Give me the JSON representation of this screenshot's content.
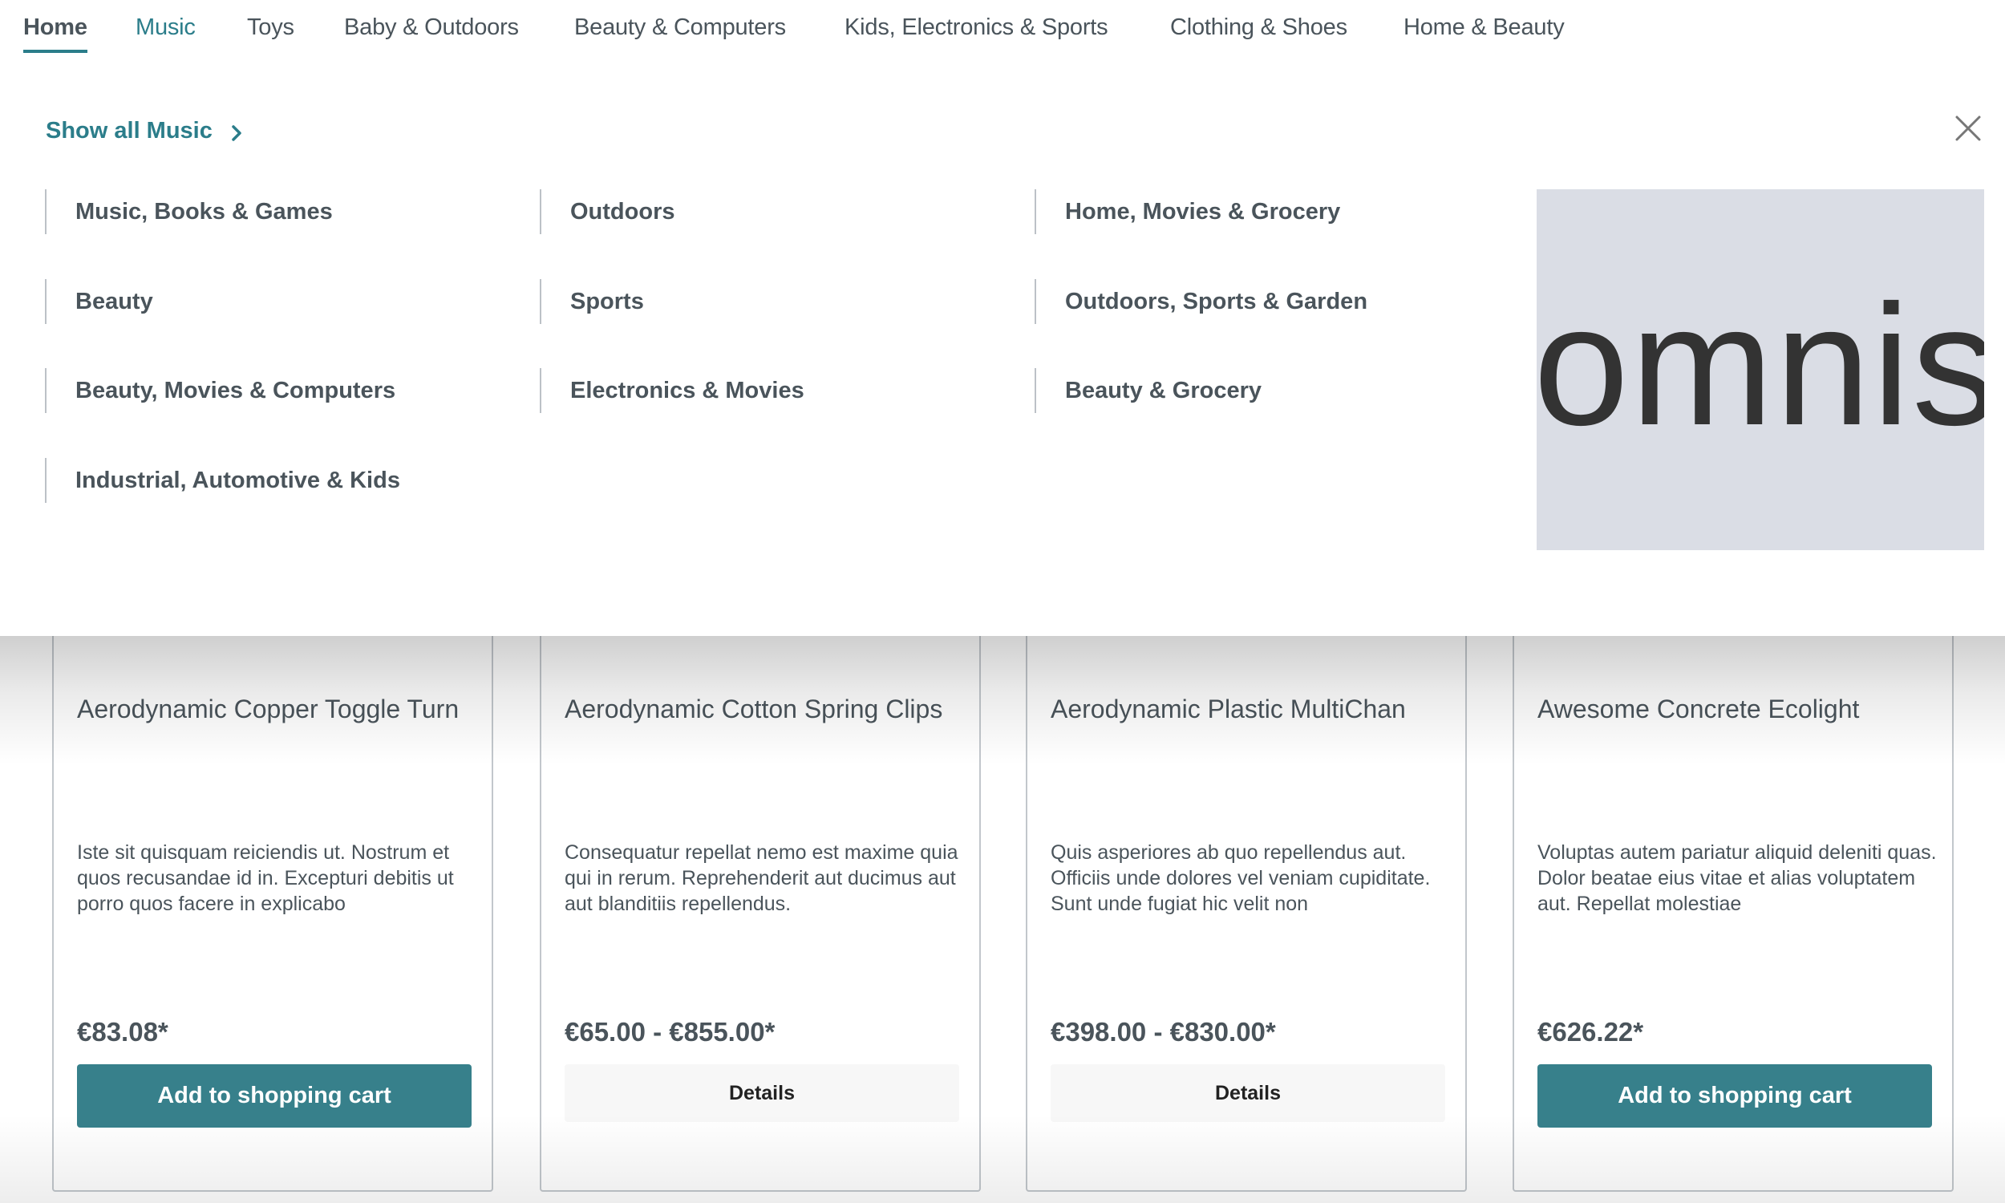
{
  "nav": {
    "items": [
      {
        "label": "Home",
        "state": "active"
      },
      {
        "label": "Music",
        "state": "open"
      },
      {
        "label": "Toys"
      },
      {
        "label": "Baby & Outdoors"
      },
      {
        "label": "Beauty & Computers"
      },
      {
        "label": "Kids, Electronics & Sports"
      },
      {
        "label": "Clothing & Shoes"
      },
      {
        "label": "Home & Beauty"
      }
    ]
  },
  "flyout": {
    "show_all_label": "Show all Music",
    "show_all_icon": "chevron-right-icon",
    "close_icon": "close-icon",
    "categories": [
      "Music, Books & Games",
      "Beauty",
      "Beauty, Movies & Computers",
      "Industrial, Automotive & Kids",
      "Outdoors",
      "Sports",
      "Electronics & Movies",
      "Home, Movies & Grocery",
      "Outdoors, Sports & Garden",
      "Beauty & Grocery"
    ],
    "promo_text": "omnis",
    "promo_bg": "#dadde5"
  },
  "products": [
    {
      "title": "Aerodynamic Copper Toggle Turn",
      "description": "Iste sit quisquam reiciendis ut. Nostrum et quos recusandae id in. Excepturi debitis ut porro quos facere in explicabo",
      "price": "€83.08*",
      "action": "Add to shopping cart"
    },
    {
      "title": "Aerodynamic Cotton Spring Clips",
      "description": "Consequatur repellat nemo est maxime quia qui in rerum. Reprehenderit aut ducimus aut aut blanditiis repellendus.",
      "price": "€65.00 - €855.00*",
      "action": "Details"
    },
    {
      "title": "Aerodynamic Plastic MultiChan",
      "description": "Quis asperiores ab quo repellendus aut. Officiis unde dolores vel veniam cupiditate. Sunt unde fugiat hic velit non",
      "price": "€398.00 - €830.00*",
      "action": "Details"
    },
    {
      "title": "Awesome Concrete Ecolight",
      "description": "Voluptas autem pariatur aliquid deleniti quas. Dolor beatae eius vitae et alias voluptatem aut. Repellat molestiae",
      "price": "€626.22*",
      "action": "Add to shopping cart"
    }
  ],
  "colors": {
    "accent": "#2b7d8a",
    "button_primary": "#37808b",
    "text": "#4a545b",
    "button_secondary": "#f7f7f7"
  }
}
